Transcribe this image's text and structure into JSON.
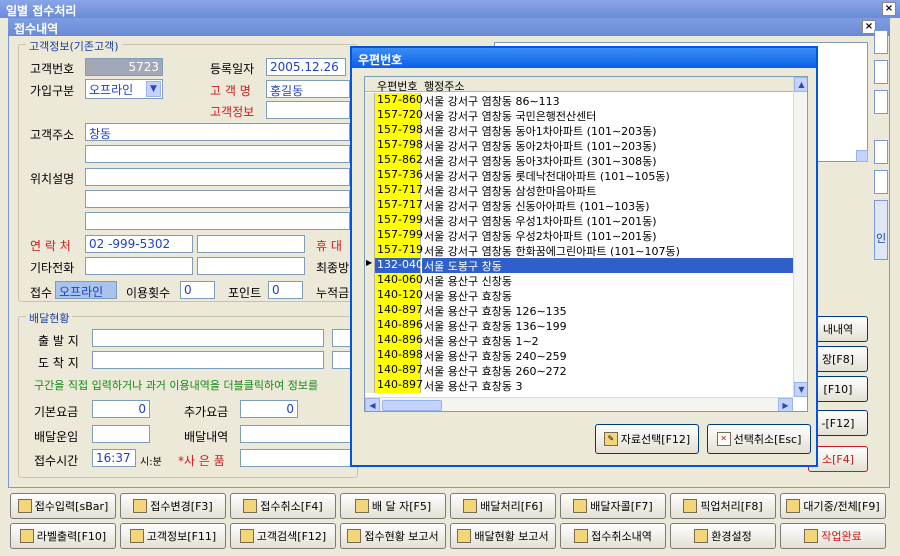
{
  "window": {
    "title": "일별 접수처리",
    "close": "×"
  },
  "inner": {
    "title": "접수내역",
    "close": "×"
  },
  "customer": {
    "group": "고객정보(기존고객)",
    "id_label": "고객번호",
    "id_value": "5723",
    "reg_date_label": "등록일자",
    "reg_date_value": "2005.12.26",
    "join_type_label": "가입구분",
    "join_type_value": "오프라인",
    "name_label": "고 객 명",
    "name_value": "홍길동",
    "info_label": "고객정보",
    "address_label": "고객주소",
    "address_value": "창동",
    "location_label": "위치설명",
    "contact_label": "연 락 처",
    "contact_value": "02   -999-5302",
    "mobile_label": "휴 대",
    "other_phone_label": "기타전화",
    "last_label": "최종방",
    "receipt_label": "접수",
    "receipt_value": "오프라인",
    "use_count_label": "이용횟수",
    "use_count_value": "0",
    "point_label": "포인트",
    "point_value": "0",
    "cumulative_label": "누적금"
  },
  "delivery": {
    "group": "배달현황",
    "departure_label": "출 발 지",
    "arrival_label": "도 착 지",
    "hint": "구간을 직접 입력하거나 과거 이용내역을 더블클릭하여 정보를",
    "base_fee_label": "기본요금",
    "base_fee_value": "0",
    "extra_fee_label": "추가요금",
    "extra_fee_value": "0",
    "driver_label": "배달운임",
    "detail_label": "배달내역",
    "time_label": "접수시간",
    "time_value": "16:37",
    "time_unit": "시:분",
    "gift_label": "*사 은 품"
  },
  "right_buttons": [
    "내내역",
    "장[F8]",
    "[F10]",
    "-[F12]",
    "소[F4]"
  ],
  "popup": {
    "title": "우편번호",
    "col_zip": "우편번호",
    "col_addr": "행정주소",
    "rows": [
      {
        "zip": "157-860",
        "addr": "서울 강서구 염창동 86∼113"
      },
      {
        "zip": "157-720",
        "addr": "서울 강서구 염창동 국민은행전산센터"
      },
      {
        "zip": "157-798",
        "addr": "서울 강서구 염창동 동아1차아파트 (101∼203동)"
      },
      {
        "zip": "157-798",
        "addr": "서울 강서구 염창동 동아2차아파트 (101∼203동)"
      },
      {
        "zip": "157-862",
        "addr": "서울 강서구 염창동 동아3차아파트 (301∼308동)"
      },
      {
        "zip": "157-736",
        "addr": "서울 강서구 염창동 롯데낙천대아파트 (101∼105동)"
      },
      {
        "zip": "157-717",
        "addr": "서울 강서구 염창동 삼성한마음아파트"
      },
      {
        "zip": "157-717",
        "addr": "서울 강서구 염창동 신동아아파트 (101∼103동)"
      },
      {
        "zip": "157-799",
        "addr": "서울 강서구 염창동 우성1차아파트 (101∼201동)"
      },
      {
        "zip": "157-799",
        "addr": "서울 강서구 염창동 우성2차아파트 (101∼201동)"
      },
      {
        "zip": "157-719",
        "addr": "서울 강서구 염창동 한화꿈에그린아파트 (101∼107동)"
      },
      {
        "zip": "132-040",
        "addr": "서울 도봉구 창동"
      },
      {
        "zip": "140-060",
        "addr": "서울 용산구 신창동"
      },
      {
        "zip": "140-120",
        "addr": "서울 용산구 효창동"
      },
      {
        "zip": "140-897",
        "addr": "서울 용산구 효창동 126∼135"
      },
      {
        "zip": "140-896",
        "addr": "서울 용산구 효창동 136∼199"
      },
      {
        "zip": "140-896",
        "addr": "서울 용산구 효창동 1∼2"
      },
      {
        "zip": "140-898",
        "addr": "서울 용산구 효창동 240∼259"
      },
      {
        "zip": "140-897",
        "addr": "서울 용산구 효창동 260∼272"
      },
      {
        "zip": "140-897",
        "addr": "서울 용산구 효창동 3"
      }
    ],
    "selected_index": 11,
    "select_button": "자료선택[F12]",
    "cancel_button": "선택취소[Esc]"
  },
  "bottom_row1": [
    "접수입력[sBar]",
    "접수변경[F3]",
    "접수취소[F4]",
    "배 달 자[F5]",
    "배달처리[F6]",
    "배달자콜[F7]",
    "픽업처리[F8]",
    "대기중/전체[F9]"
  ],
  "bottom_row2": [
    "라벨출력[F10]",
    "고객정보[F11]",
    "고객검색[F12]",
    "접수현황 보고서",
    "배달현황 보고서",
    "접수취소내역",
    "환경설정",
    "작업완료"
  ],
  "right_edge_label": "인"
}
